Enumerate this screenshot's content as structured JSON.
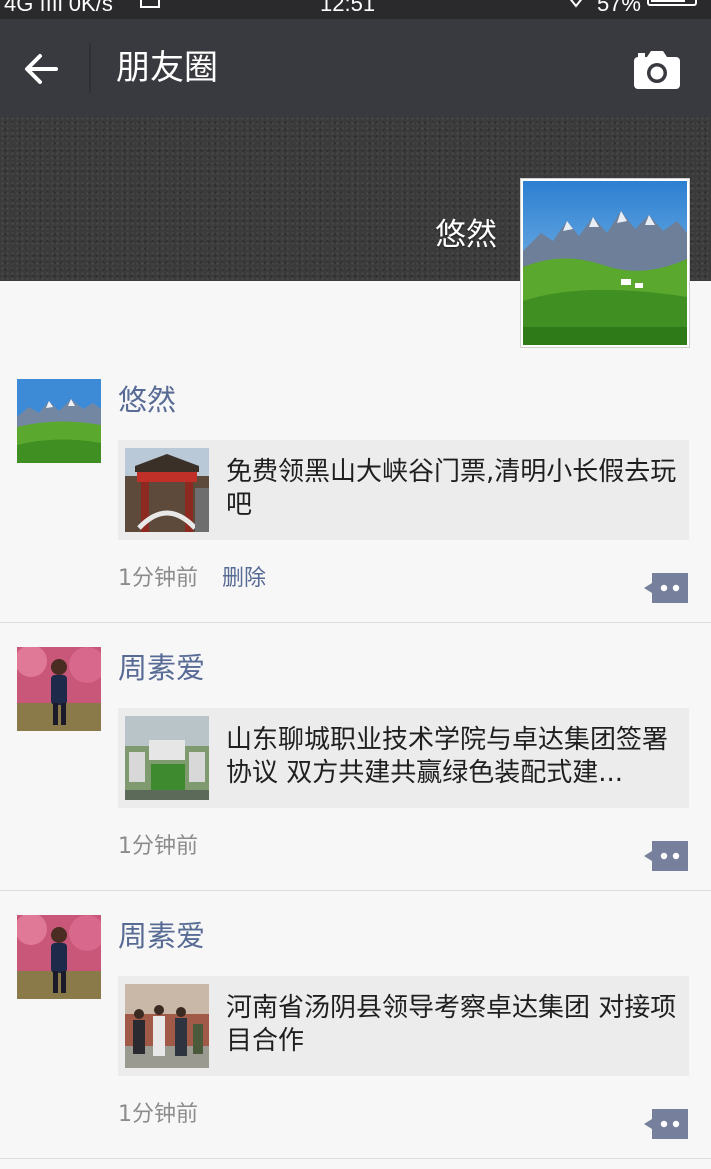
{
  "status_bar": {
    "left": "4G ıııl 0K/s",
    "time": "12:51",
    "battery": "57%"
  },
  "header": {
    "title": "朋友圈",
    "back_icon": "back-arrow-icon",
    "camera_icon": "camera-icon",
    "background": "#393a3f"
  },
  "cover": {
    "user_name": "悠然"
  },
  "link_color": "#576b95",
  "posts": [
    {
      "author": "悠然",
      "link_title": "免费领黑山大峡谷门票,清明小长假去玩吧",
      "time": "1分钟前",
      "delete_label": "删除"
    },
    {
      "author": "周素爱",
      "link_title": "山东聊城职业技术学院与卓达集团签署协议 双方共建共赢绿色装配式建...",
      "time": "1分钟前"
    },
    {
      "author": "周素爱",
      "link_title": "河南省汤阴县领导考察卓达集团 对接项目合作",
      "time": "1分钟前"
    }
  ]
}
